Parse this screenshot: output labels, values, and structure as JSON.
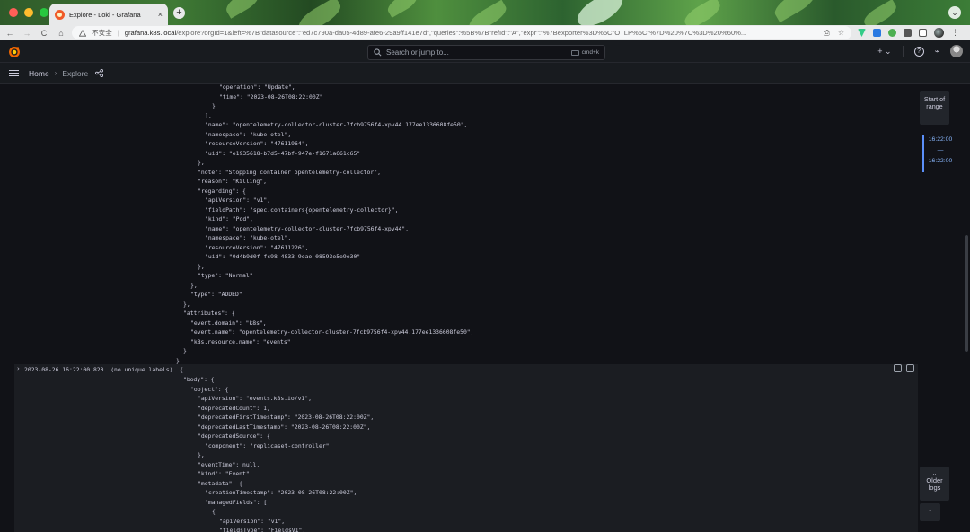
{
  "browser": {
    "tab_title": "Explore - Loki - Grafana",
    "tab_close": "×",
    "new_tab": "+",
    "tab_dropdown": "⌄",
    "nav": {
      "back": "←",
      "forward": "→",
      "reload": "C",
      "home": "⌂"
    },
    "security_label": "不安全",
    "url_host": "grafana.k8s.local",
    "url_rest": "/explore?orgId=1&left=%7B\"datasource\":\"ed7c790a-da05-4d89-afe6-29a9ff141e7d\",\"queries\":%5B%7B\"refId\":\"A\",\"expr\":\"%7Bexporter%3D%5C\"OTLP%5C\"%7D%20%7C%3D%20%60%..."
  },
  "grafana": {
    "search_placeholder": "Search or jump to...",
    "search_shortcut": "cmd+k",
    "add_label": "+ ⌄",
    "help_icon": "?",
    "rss_icon": "⌁",
    "breadcrumb": {
      "home": "Home",
      "separator": "›",
      "current": "Explore"
    }
  },
  "logs": {
    "upper_lines": [
      {
        "indent": 244,
        "text": "\"operation\": \"Update\","
      },
      {
        "indent": 244,
        "text": "\"time\": \"2023-08-26T08:22:00Z\""
      },
      {
        "indent": 236,
        "text": "}"
      },
      {
        "indent": 228,
        "text": "],"
      },
      {
        "indent": 228,
        "text": "\"name\": \"opentelemetry-collector-cluster-7fcb9756f4-xpv44.177ee1336608fe50\","
      },
      {
        "indent": 228,
        "text": "\"namespace\": \"kube-otel\","
      },
      {
        "indent": 228,
        "text": "\"resourceVersion\": \"47611964\","
      },
      {
        "indent": 228,
        "text": "\"uid\": \"e1935618-b7d5-47bf-947e-f1671a661c65\""
      },
      {
        "indent": 220,
        "text": "},"
      },
      {
        "indent": 220,
        "text": "\"note\": \"Stopping container opentelemetry-collector\","
      },
      {
        "indent": 220,
        "text": "\"reason\": \"Killing\","
      },
      {
        "indent": 220,
        "text": "\"regarding\": {"
      },
      {
        "indent": 228,
        "text": "\"apiVersion\": \"v1\","
      },
      {
        "indent": 228,
        "text": "\"fieldPath\": \"spec.containers{opentelemetry-collector}\","
      },
      {
        "indent": 228,
        "text": "\"kind\": \"Pod\","
      },
      {
        "indent": 228,
        "text": "\"name\": \"opentelemetry-collector-cluster-7fcb9756f4-xpv44\","
      },
      {
        "indent": 228,
        "text": "\"namespace\": \"kube-otel\","
      },
      {
        "indent": 228,
        "text": "\"resourceVersion\": \"47611226\","
      },
      {
        "indent": 228,
        "text": "\"uid\": \"0d4b9d0f-fc98-4833-9eae-08593e5e9e30\""
      },
      {
        "indent": 220,
        "text": "},"
      },
      {
        "indent": 220,
        "text": "\"type\": \"Normal\""
      },
      {
        "indent": 212,
        "text": "},"
      },
      {
        "indent": 212,
        "text": "\"type\": \"ADDED\""
      },
      {
        "indent": 204,
        "text": "},"
      },
      {
        "indent": 204,
        "text": "\"attributes\": {"
      },
      {
        "indent": 212,
        "text": "\"event.domain\": \"k8s\","
      },
      {
        "indent": 212,
        "text": "\"event.name\": \"opentelemetry-collector-cluster-7fcb9756f4-xpv44.177ee1336608fe50\","
      },
      {
        "indent": 212,
        "text": "\"k8s.resource.name\": \"events\""
      },
      {
        "indent": 204,
        "text": "}"
      },
      {
        "indent": 196,
        "text": "}"
      }
    ],
    "row": {
      "caret": "›",
      "timestamp": "2023-08-26 16:22:00.820",
      "labels": "(no unique labels)",
      "open": "{"
    },
    "lower_lines": [
      {
        "indent": 204,
        "text": "\"body\": {"
      },
      {
        "indent": 212,
        "text": "\"object\": {"
      },
      {
        "indent": 220,
        "text": "\"apiVersion\": \"events.k8s.io/v1\","
      },
      {
        "indent": 220,
        "text": "\"deprecatedCount\": 1,"
      },
      {
        "indent": 220,
        "text": "\"deprecatedFirstTimestamp\": \"2023-08-26T08:22:00Z\","
      },
      {
        "indent": 220,
        "text": "\"deprecatedLastTimestamp\": \"2023-08-26T08:22:00Z\","
      },
      {
        "indent": 220,
        "text": "\"deprecatedSource\": {"
      },
      {
        "indent": 228,
        "text": "\"component\": \"replicaset-controller\""
      },
      {
        "indent": 220,
        "text": "},"
      },
      {
        "indent": 220,
        "text": "\"eventTime\": null,"
      },
      {
        "indent": 220,
        "text": "\"kind\": \"Event\","
      },
      {
        "indent": 220,
        "text": "\"metadata\": {"
      },
      {
        "indent": 228,
        "text": "\"creationTimestamp\": \"2023-08-26T08:22:00Z\","
      },
      {
        "indent": 228,
        "text": "\"managedFields\": ["
      },
      {
        "indent": 236,
        "text": "{"
      },
      {
        "indent": 244,
        "text": "\"apiVersion\": \"v1\","
      },
      {
        "indent": 244,
        "text": "\"fieldsType\": \"FieldsV1\","
      }
    ]
  },
  "navigation": {
    "start_of_range": "Start of range",
    "range_from": "16:22:00",
    "range_dash": "—",
    "range_to": "16:22:00",
    "older_logs_chevron": "⌄",
    "older_logs": "Older logs",
    "scroll_top": "↑"
  }
}
